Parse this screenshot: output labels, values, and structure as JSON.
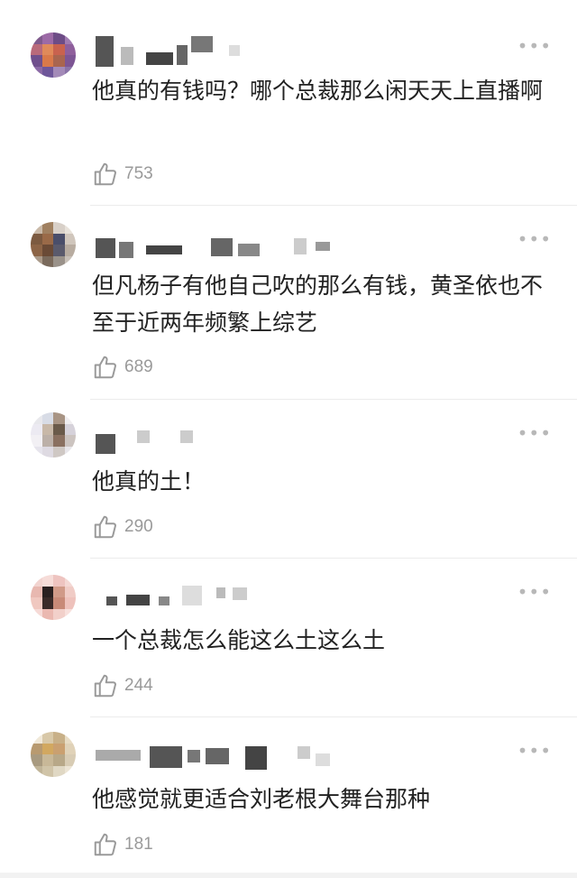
{
  "comments": [
    {
      "text": "他真的有钱吗？哪个总裁那么闲天天上直播啊",
      "likes": "753",
      "more": "•••"
    },
    {
      "text": "但凡杨子有他自己吹的那么有钱，黄圣依也不至于近两年频繁上综艺",
      "likes": "689",
      "more": "•••"
    },
    {
      "text": "他真的土！",
      "likes": "290",
      "more": "•••"
    },
    {
      "text": "一个总裁怎么能这么土这么土",
      "likes": "244",
      "more": "•••"
    },
    {
      "text": "他感觉就更适合刘老根大舞台那种",
      "likes": "181",
      "more": "•••"
    }
  ],
  "icons": {
    "like": "thumbs-up-icon",
    "more": "more-dots-icon"
  },
  "colors": {
    "text": "#222222",
    "meta": "#9a9a9a",
    "divider": "#ececec"
  }
}
